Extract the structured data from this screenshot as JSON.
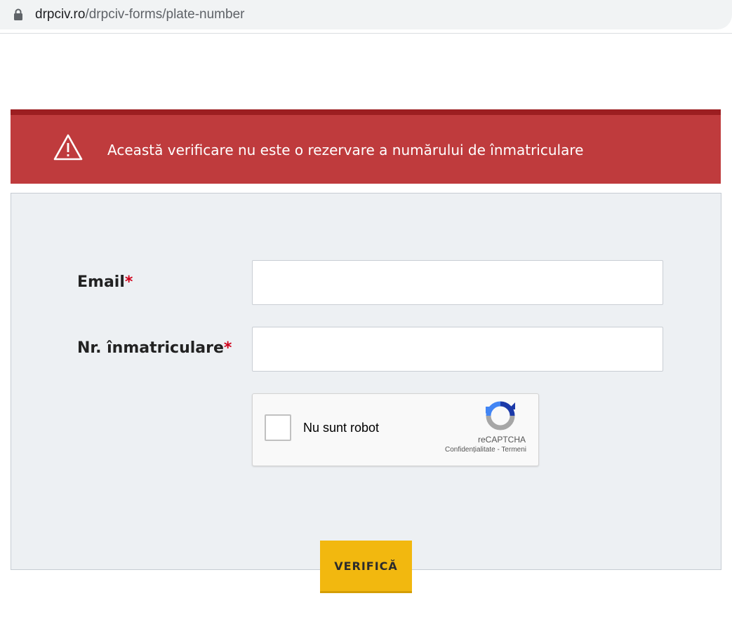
{
  "browser": {
    "url_host": "drpciv.ro",
    "url_path": "/drpciv-forms/plate-number",
    "lock_icon": "lock-icon"
  },
  "alert": {
    "icon": "warning-triangle-icon",
    "text": "Această verificare nu este o rezervare a numărului de înmatriculare",
    "background": "#bf3b3d"
  },
  "form": {
    "email": {
      "label": "Email",
      "required_mark": "*",
      "value": ""
    },
    "plate": {
      "label": "Nr. înmatriculare",
      "required_mark": "*",
      "value": ""
    },
    "captcha": {
      "label": "Nu sunt robot",
      "brand": "reCAPTCHA",
      "privacy_link": "Confidențialitate",
      "separator": " - ",
      "terms_link": "Termeni",
      "checked": false
    },
    "submit_label": "VERIFICĂ",
    "accent": "#f2b80f"
  }
}
